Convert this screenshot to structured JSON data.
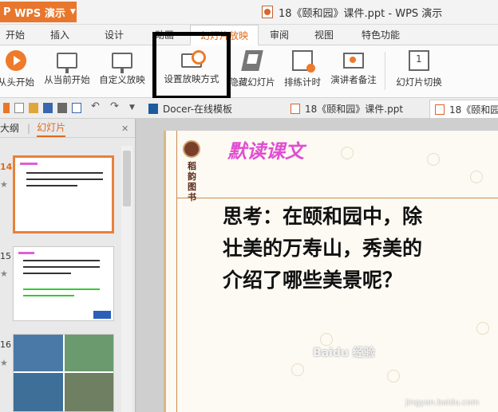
{
  "app": {
    "name": "WPS 演示",
    "logo_mark": "P"
  },
  "window": {
    "title": "18《颐和园》课件.ppt - WPS 演示"
  },
  "ribbon_tabs": [
    {
      "label": "开始",
      "active": false
    },
    {
      "label": "插入",
      "active": false
    },
    {
      "label": "设计",
      "active": false
    },
    {
      "label": "动画",
      "active": false
    },
    {
      "label": "幻灯片放映",
      "active": true
    },
    {
      "label": "审阅",
      "active": false
    },
    {
      "label": "视图",
      "active": false
    },
    {
      "label": "特色功能",
      "active": false
    }
  ],
  "toolbar": {
    "from_start": "从头开始",
    "from_current": "从当前开始",
    "custom_show": "自定义放映",
    "setup_show": "设置放映方式",
    "hide_slide": "隐藏幻灯片",
    "rehearse_timings": "排练计时",
    "presenter_notes": "演讲者备注",
    "slide_transition": "幻灯片切换"
  },
  "doc_tabs": [
    {
      "label": "Docer-在线模板",
      "active": false
    },
    {
      "label": "18《颐和园》课件.ppt",
      "active": false
    },
    {
      "label": "18《颐和园",
      "active": true
    }
  ],
  "left_panel": {
    "tab_outline": "大纲",
    "tab_slides": "幻灯片",
    "slides": [
      {
        "number": "14",
        "selected": true
      },
      {
        "number": "15",
        "selected": false
      },
      {
        "number": "16",
        "selected": false
      }
    ]
  },
  "slide": {
    "heading": "默读课文",
    "seal_text": "稻韵图书",
    "body_lines": [
      "思考：在颐和园中，除",
      "壮美的万寿山，秀美的",
      "介绍了哪些美景呢？"
    ]
  },
  "watermark": {
    "text": "Baidu 经验",
    "sub": "jingyan.baidu.com"
  },
  "colors": {
    "accent": "#e8762c",
    "heading_pink": "#e04fd3",
    "highlight_box": "#000000"
  }
}
